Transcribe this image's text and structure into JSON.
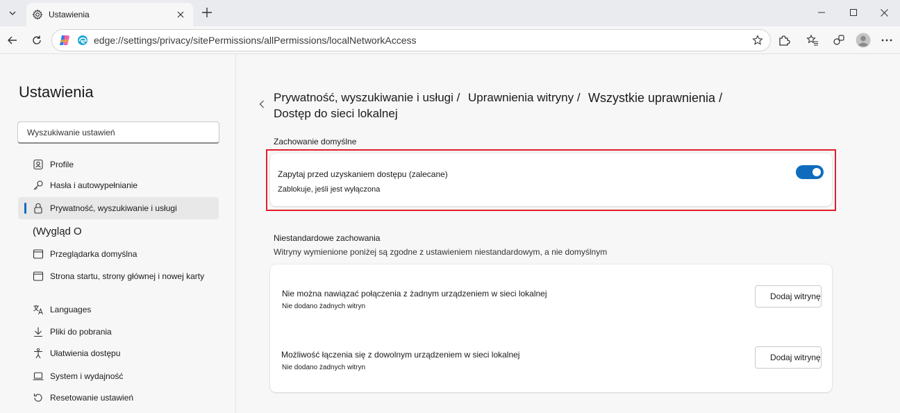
{
  "tab": {
    "title": "Ustawienia"
  },
  "address": {
    "url": "edge://settings/privacy/sitePermissions/allPermissions/localNetworkAccess"
  },
  "sidebar": {
    "title": "Ustawienia",
    "search_placeholder": "Wyszukiwanie ustawień",
    "items": [
      {
        "label": "Profile",
        "icon": "profile-icon"
      },
      {
        "label": "Hasła i autowypełnianie",
        "icon": "key-icon"
      },
      {
        "label": "Prywatność, wyszukiwanie i usługi",
        "icon": "lock-icon",
        "active": true
      },
      {
        "label": "(Wygląd O",
        "icon": ""
      },
      {
        "label": "Przeglądarka domyślna",
        "icon": "browser-icon"
      },
      {
        "label": "Strona startu, strony głównej i nowej karty",
        "icon": "home-icon"
      },
      {
        "label": "Languages",
        "icon": "languages-icon"
      },
      {
        "label": "Pliki do pobrania",
        "icon": "download-icon"
      },
      {
        "label": "Ułatwienia dostępu",
        "icon": "accessibility-icon"
      },
      {
        "label": "System i wydajność",
        "icon": "laptop-icon"
      },
      {
        "label": "Resetowanie ustawień",
        "icon": "reset-icon"
      }
    ]
  },
  "breadcrumb": {
    "part1": "Prywatność, wyszukiwanie i usługi /",
    "part2": "Uprawnienia witryny /",
    "part3": "Wszystkie uprawnienia /",
    "part4": "Dostęp do sieci lokalnej"
  },
  "default_section": {
    "heading": "Zachowanie domyślne",
    "setting_title": "Zapytaj przed uzyskaniem dostępu (zalecane)",
    "setting_desc": "Zablokuje, jeśli jest wyłączona",
    "toggle_on": true
  },
  "custom_section": {
    "heading": "Niestandardowe zachowania",
    "subheading": "Witryny wymienione poniżej są zgodne z ustawieniem niestandardowym, a nie domyślnym",
    "rows": [
      {
        "title": "Nie można nawiązać połączenia z żadnym urządzeniem w sieci lokalnej",
        "desc": "Nie dodano żadnych witryn",
        "button": "Dodaj witrynę"
      },
      {
        "title": "Możliwość łączenia się z dowolnym urządzeniem w sieci lokalnej",
        "desc": "Nie dodano żadnych witryn",
        "button": "Dodaj witrynę"
      }
    ]
  },
  "colors": {
    "accent": "#0f6cbd",
    "highlight": "#e01e2b"
  }
}
